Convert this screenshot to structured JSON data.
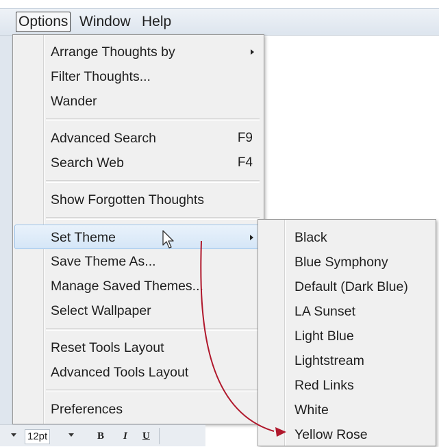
{
  "menubar": {
    "items": [
      {
        "label": "Options",
        "active": true
      },
      {
        "label": "Window",
        "active": false
      },
      {
        "label": "Help",
        "active": false
      }
    ]
  },
  "options_menu": {
    "items": [
      {
        "label": "Arrange Thoughts by",
        "shortcut": "",
        "submenu": true
      },
      {
        "label": "Filter Thoughts...",
        "shortcut": "",
        "submenu": false
      },
      {
        "label": "Wander",
        "shortcut": "",
        "submenu": false
      },
      {
        "label": "Advanced Search",
        "shortcut": "F9",
        "submenu": false
      },
      {
        "label": "Search Web",
        "shortcut": "F4",
        "submenu": false
      },
      {
        "label": "Show Forgotten Thoughts",
        "shortcut": "",
        "submenu": false
      },
      {
        "label": "Set Theme",
        "shortcut": "",
        "submenu": true,
        "highlighted": true
      },
      {
        "label": "Save Theme As...",
        "shortcut": "",
        "submenu": false
      },
      {
        "label": "Manage Saved Themes...",
        "shortcut": "",
        "submenu": false
      },
      {
        "label": "Select Wallpaper",
        "shortcut": "",
        "submenu": false
      },
      {
        "label": "Reset Tools Layout",
        "shortcut": "",
        "submenu": false
      },
      {
        "label": "Advanced Tools Layout",
        "shortcut": "",
        "submenu": false
      },
      {
        "label": "Preferences",
        "shortcut": "",
        "submenu": false
      }
    ]
  },
  "theme_submenu": {
    "items": [
      "Black",
      "Blue Symphony",
      "Default (Dark Blue)",
      "LA Sunset",
      "Light Blue",
      "Lightstream",
      "Red Links",
      "White",
      "Yellow Rose"
    ]
  },
  "toolbar": {
    "font_size": "12pt",
    "bold": "B",
    "italic": "I",
    "underline": "U"
  },
  "annotation": {
    "color": "#b0182c",
    "target": "Yellow Rose"
  },
  "colors": {
    "highlight": "#d5e6f7",
    "menu_bg": "#f0f0f0"
  }
}
